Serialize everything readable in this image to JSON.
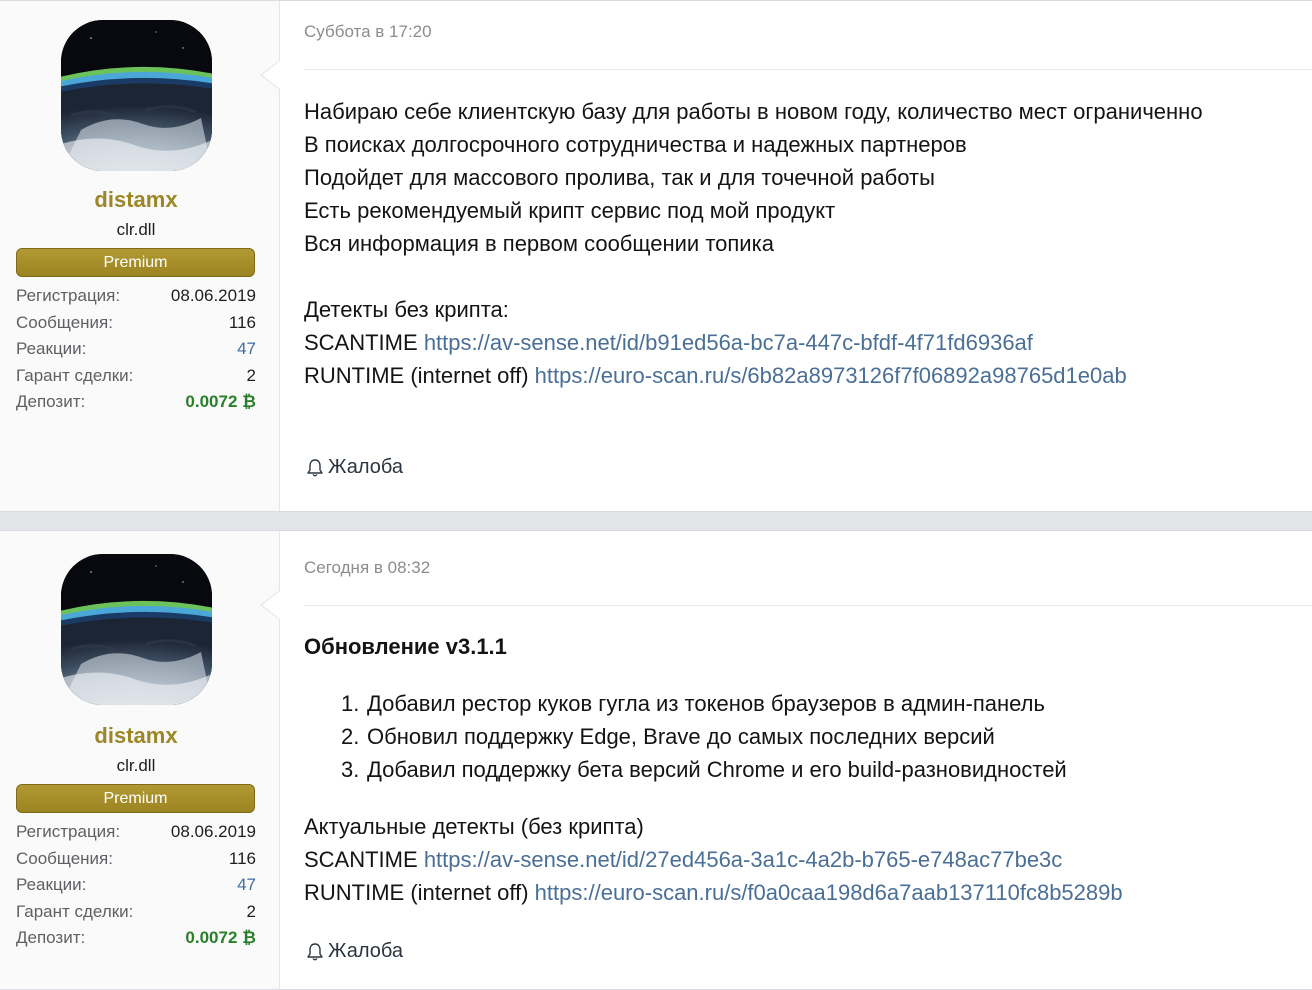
{
  "posts": [
    {
      "user": {
        "name": "distamx",
        "title": "clr.dll",
        "banner": "Premium",
        "stats": [
          {
            "label": "Регистрация:",
            "value": "08.06.2019"
          },
          {
            "label": "Сообщения:",
            "value": "116"
          },
          {
            "label": "Реакции:",
            "value": "47"
          },
          {
            "label": "Гарант сделки:",
            "value": "2"
          },
          {
            "label": "Депозит:",
            "value": "0.0072 ₿"
          }
        ]
      },
      "date": "Суббота в 17:20",
      "lines": [
        "Набираю себе клиентскую базу для работы в новом году, количество мест ограниченно",
        "В поисках долгосрочного сотрудничества и надежных партнеров",
        "Подойдет для массового пролива, так и для точечной работы",
        "Есть рекомендуемый крипт сервис под мой продукт",
        "Вся информация в первом сообщении топика"
      ],
      "detects_title": "Детекты без крипта:",
      "scantime_label": "SCANTIME",
      "scantime_url": "https://av-sense.net/id/b91ed56a-bc7a-447c-bfdf-4f71fd6936af",
      "runtime_label": "RUNTIME (internet off)",
      "runtime_url": "https://euro-scan.ru/s/6b82a8973126f7f06892a98765d1e0ab",
      "report_label": "Жалоба"
    },
    {
      "user": {
        "name": "distamx",
        "title": "clr.dll",
        "banner": "Premium",
        "stats": [
          {
            "label": "Регистрация:",
            "value": "08.06.2019"
          },
          {
            "label": "Сообщения:",
            "value": "116"
          },
          {
            "label": "Реакции:",
            "value": "47"
          },
          {
            "label": "Гарант сделки:",
            "value": "2"
          },
          {
            "label": "Депозит:",
            "value": "0.0072 ₿"
          }
        ]
      },
      "date": "Сегодня в 08:32",
      "heading": "Обновление v3.1.1",
      "updates": [
        {
          "num": "1.",
          "text": "Добавил рестор куков гугла из токенов браузеров в админ-панель"
        },
        {
          "num": "2.",
          "text": "Обновил поддержку Edge, Brave до самых последних версий"
        },
        {
          "num": "3.",
          "text": "Добавил поддержку бета версий Chrome и его build-разновидностей"
        }
      ],
      "detects_title": "Актуальные детекты (без крипта)",
      "scantime_label": "SCANTIME",
      "scantime_url": "https://av-sense.net/id/27ed456a-3a1c-4a2b-b765-e748ac77be3c",
      "runtime_label": "RUNTIME (internet off)",
      "runtime_url": "https://euro-scan.ru/s/f0a0caa198d6a7aab137110fc8b5289b",
      "report_label": "Жалоба"
    }
  ],
  "colors": {
    "username": "#9c8626",
    "banner": "#a88f2b",
    "link": "#4a6f96",
    "deposit": "#2a7f2a"
  }
}
